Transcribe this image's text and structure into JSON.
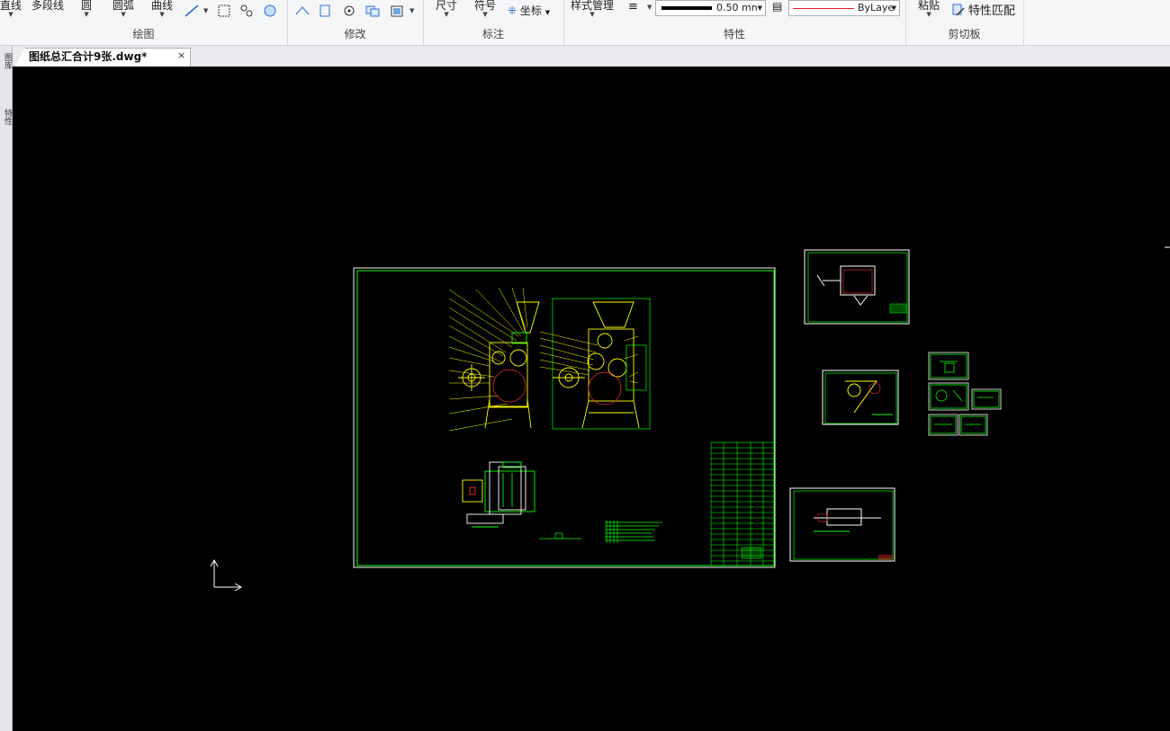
{
  "ribbon": {
    "draw": {
      "label": "绘图",
      "line": "直线",
      "polyline": "多段线",
      "circle": "圆",
      "arc": "圆弧",
      "curve": "曲线"
    },
    "modify": {
      "label": "修改"
    },
    "annotate": {
      "label": "标注",
      "dimension": "尺寸",
      "symbol": "符号",
      "coordinate": "坐标"
    },
    "properties": {
      "label": "特性",
      "style_manager": "样式管理",
      "lineweight": "0.50 mn",
      "linetype": "ByLaye"
    },
    "clipboard": {
      "label": "剪切板",
      "paste": "粘贴",
      "match_properties": "特性匹配"
    }
  },
  "document": {
    "tab_title": "图纸总汇合计9张.dwg*",
    "close_glyph": "×"
  },
  "left_panel": {
    "tabs": [
      "图库",
      "特性"
    ]
  },
  "colors": {
    "canvas": "#000000",
    "frame": "#00ff00",
    "drawing": "#ffff00",
    "accent": "#ff0000",
    "annotation": "#00ffff",
    "sheet": "#ffffff"
  }
}
